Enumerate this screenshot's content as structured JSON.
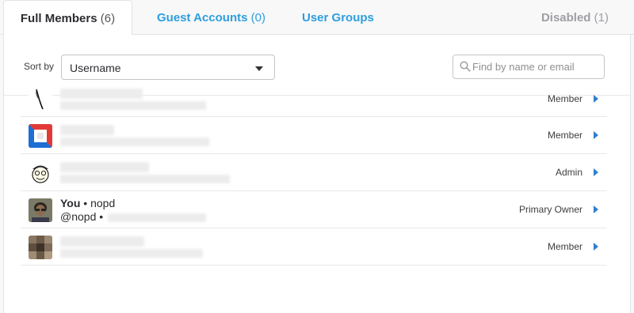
{
  "tabs": {
    "full_members": {
      "label": "Full Members",
      "count": "(6)"
    },
    "guest_accounts": {
      "label": "Guest Accounts",
      "count": "(0)"
    },
    "user_groups": {
      "label": "User Groups"
    },
    "disabled": {
      "label": "Disabled",
      "count": "(1)"
    }
  },
  "controls": {
    "sort_label": "Sort by",
    "sort_value": "Username",
    "search_placeholder": "Find by name or email"
  },
  "members": [
    {
      "role": "Member",
      "avatar": "quill-avatar"
    },
    {
      "role": "Member",
      "avatar": "blue-red-logo-avatar"
    },
    {
      "role": "Admin",
      "avatar": "cartoon-face-avatar"
    },
    {
      "role": "Primary Owner",
      "avatar": "photo-avatar",
      "you_label": "You",
      "bullet": "•",
      "name": "nopd",
      "handle": "@nopd"
    },
    {
      "role": "Member",
      "avatar": "pixelated-avatar"
    }
  ],
  "colors": {
    "link": "#2d9ee0",
    "arrow": "#2d7fd0"
  }
}
